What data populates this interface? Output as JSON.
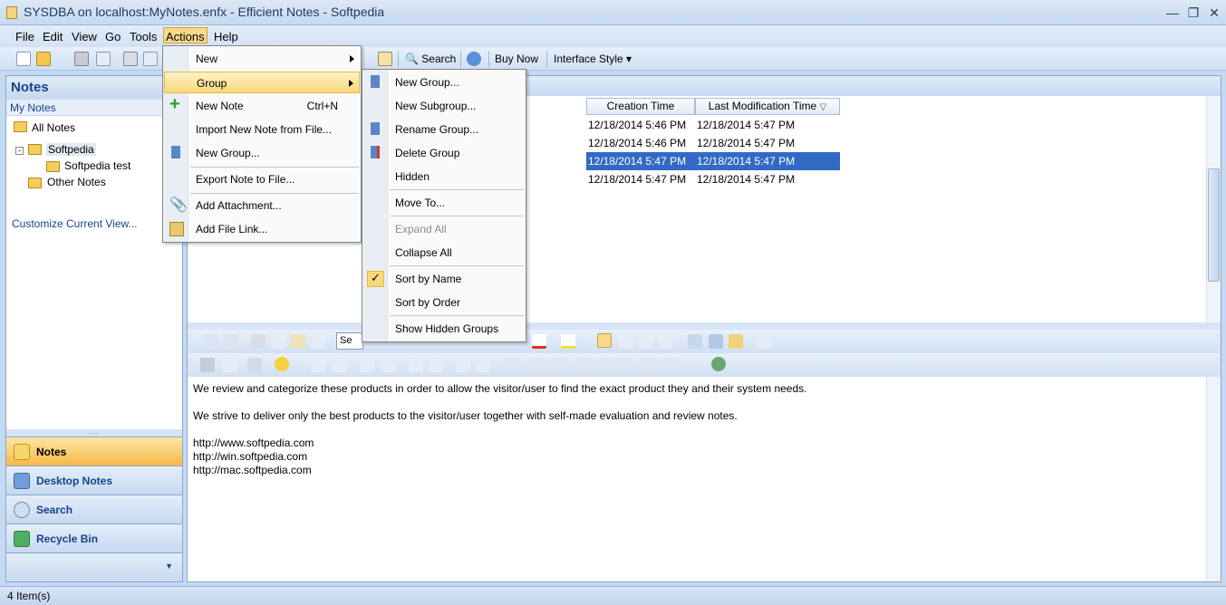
{
  "window": {
    "title": "SYSDBA on localhost:MyNotes.enfx - Efficient Notes - Softpedia"
  },
  "menubar": [
    "File",
    "Edit",
    "View",
    "Go",
    "Tools",
    "Actions",
    "Help"
  ],
  "toolbar": {
    "search": "Search",
    "buy_now": "Buy Now",
    "interface_style": "Interface Style"
  },
  "left_pane": {
    "header": "Notes",
    "subheader": "My Notes",
    "all_notes": "All Notes",
    "tree": [
      "Softpedia",
      "Softpedia test",
      "Other Notes"
    ],
    "customize": "Customize Current View...",
    "nav": [
      "Notes",
      "Desktop Notes",
      "Search",
      "Recycle Bin"
    ]
  },
  "grid": {
    "columns": [
      "Creation Time",
      "Last Modification Time"
    ],
    "rows": [
      [
        "12/18/2014 5:46 PM",
        "12/18/2014 5:47 PM"
      ],
      [
        "12/18/2014 5:46 PM",
        "12/18/2014 5:47 PM"
      ],
      [
        "12/18/2014 5:47 PM",
        "12/18/2014 5:47 PM"
      ],
      [
        "12/18/2014 5:47 PM",
        "12/18/2014 5:47 PM"
      ]
    ]
  },
  "editor": {
    "font_partial": "Se",
    "p1": "We review and categorize these products in order to allow the visitor/user to find the exact product they and their system needs.",
    "p2": "We strive to deliver only the best products to the visitor/user together with self-made evaluation and review notes.",
    "links": [
      "http://www.softpedia.com",
      "http://win.softpedia.com",
      "http://mac.softpedia.com"
    ]
  },
  "actions_menu": {
    "new": "New",
    "group": "Group",
    "new_note": "New Note",
    "new_note_shortcut": "Ctrl+N",
    "import": "Import New Note from File...",
    "new_group": "New Group...",
    "export": "Export Note to File...",
    "add_attachment": "Add Attachment...",
    "add_file_link": "Add File Link..."
  },
  "group_menu": {
    "new_group": "New Group...",
    "new_subgroup": "New Subgroup...",
    "rename_group": "Rename Group...",
    "delete_group": "Delete Group",
    "hidden": "Hidden",
    "move_to": "Move To...",
    "expand_all": "Expand All",
    "collapse_all": "Collapse All",
    "sort_by_name": "Sort by Name",
    "sort_by_order": "Sort by Order",
    "show_hidden": "Show Hidden Groups"
  },
  "status": {
    "items": "4 Item(s)"
  }
}
